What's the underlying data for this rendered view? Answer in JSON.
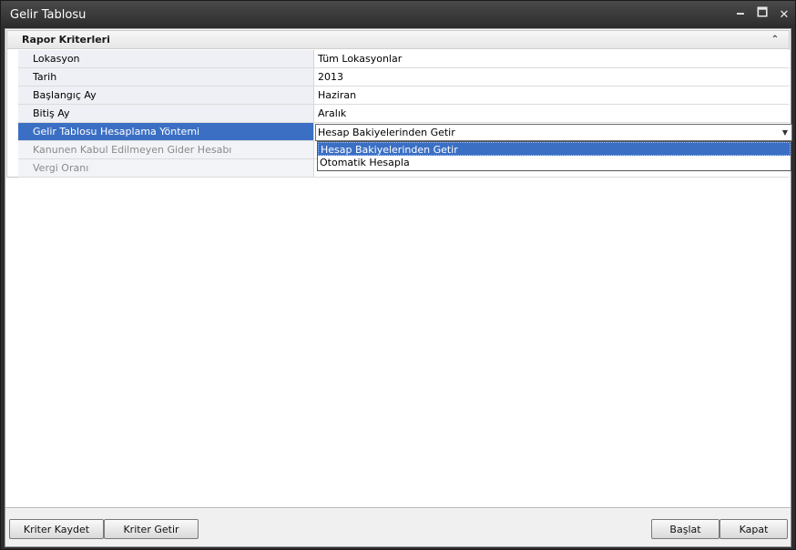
{
  "window": {
    "title": "Gelir Tablosu",
    "controls": {
      "minimize": "🗕",
      "maximize": "🗖",
      "close": "✕"
    }
  },
  "group": {
    "header": "Rapor Kriterleri",
    "collapse_glyph": "⌃"
  },
  "rows": [
    {
      "label": "Lokasyon",
      "value": "Tüm Lokasyonlar"
    },
    {
      "label": "Tarih",
      "value": "2013"
    },
    {
      "label": "Başlangıç Ay",
      "value": "Haziran"
    },
    {
      "label": "Bitiş Ay",
      "value": "Aralık"
    },
    {
      "label": "Gelir Tablosu Hesaplama Yöntemi",
      "value": "Hesap Bakiyelerinden Getir"
    },
    {
      "label": "Kanunen Kabul Edilmeyen Gider Hesabı",
      "value": ""
    },
    {
      "label": "Vergi Oranı",
      "value": ""
    }
  ],
  "dropdown": {
    "options": [
      "Hesap Bakiyelerinden Getir",
      "Otomatik Hesapla"
    ],
    "selected": "Hesap Bakiyelerinden Getir",
    "arrow": "▼"
  },
  "buttons": {
    "save": "Kriter Kaydet",
    "load": "Kriter Getir",
    "start": "Başlat",
    "close": "Kapat"
  },
  "colors": {
    "selection": "#3b6fc4",
    "titlebar": "#2b2b2b"
  }
}
